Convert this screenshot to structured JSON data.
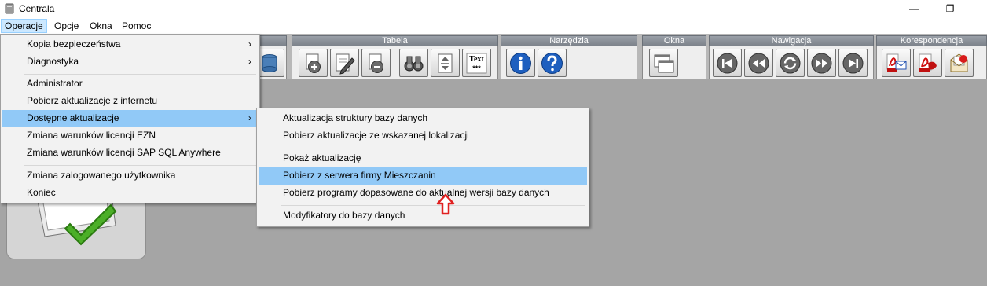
{
  "window": {
    "title": "Centrala"
  },
  "menubar": {
    "items": [
      "Operacje",
      "Opcje",
      "Okna",
      "Pomoc"
    ]
  },
  "toolbar": {
    "groups": [
      "Tabela",
      "Narzędzia",
      "Okna",
      "Nawigacja",
      "Korespondencja"
    ]
  },
  "toolbar_text_button": {
    "label": "Text",
    "sublabel": "***"
  },
  "operacje_menu": {
    "items": [
      "Kopia bezpieczeństwa",
      "Diagnostyka",
      "Administrator",
      "Pobierz aktualizacje z internetu",
      "Dostępne aktualizacje",
      "Zmiana warunków licencji EZN",
      "Zmiana warunków licencji SAP SQL Anywhere",
      "Zmiana zalogowanego użytkownika",
      "Koniec"
    ],
    "submenu_arrow": "›"
  },
  "updates_submenu": {
    "items": [
      "Aktualizacja struktury bazy danych",
      "Pobierz aktualizacje ze wskazanej lokalizacji",
      "Pokaż aktualizację",
      "Pobierz z serwera firmy Mieszczanin",
      "Pobierz programy dopasowane do aktualnej wersji bazy danych",
      "Modyfikatory do bazy danych"
    ]
  },
  "colors": {
    "highlight": "#91c9f7",
    "menu_bg": "#f2f2f2",
    "workspace": "#a5a5a5",
    "annotation_arrow": "#e02020"
  },
  "icons": [
    "app-icon",
    "minimize-icon",
    "restore-icon",
    "add-record-icon",
    "edit-record-icon",
    "delete-record-icon",
    "search-binoculars-icon",
    "sort-icon",
    "text-icon",
    "info-icon",
    "help-icon",
    "windows-icon",
    "first-record-icon",
    "previous-record-icon",
    "refresh-icon",
    "next-record-icon",
    "last-record-icon",
    "pdf-mail-icon",
    "pdf-icon",
    "envelope-icon",
    "check-icon",
    "red-arrow-icon"
  ]
}
